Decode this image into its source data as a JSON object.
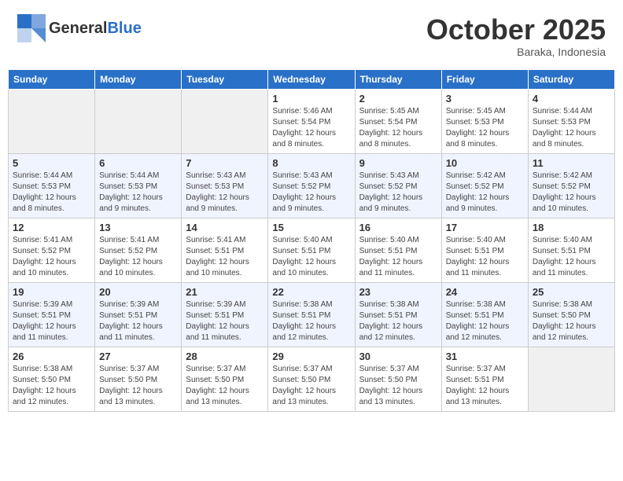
{
  "header": {
    "logo_line1": "General",
    "logo_line2": "Blue",
    "month": "October 2025",
    "location": "Baraka, Indonesia"
  },
  "weekdays": [
    "Sunday",
    "Monday",
    "Tuesday",
    "Wednesday",
    "Thursday",
    "Friday",
    "Saturday"
  ],
  "weeks": [
    [
      {
        "day": "",
        "info": ""
      },
      {
        "day": "",
        "info": ""
      },
      {
        "day": "",
        "info": ""
      },
      {
        "day": "1",
        "info": "Sunrise: 5:46 AM\nSunset: 5:54 PM\nDaylight: 12 hours and 8 minutes."
      },
      {
        "day": "2",
        "info": "Sunrise: 5:45 AM\nSunset: 5:54 PM\nDaylight: 12 hours and 8 minutes."
      },
      {
        "day": "3",
        "info": "Sunrise: 5:45 AM\nSunset: 5:53 PM\nDaylight: 12 hours and 8 minutes."
      },
      {
        "day": "4",
        "info": "Sunrise: 5:44 AM\nSunset: 5:53 PM\nDaylight: 12 hours and 8 minutes."
      }
    ],
    [
      {
        "day": "5",
        "info": "Sunrise: 5:44 AM\nSunset: 5:53 PM\nDaylight: 12 hours and 8 minutes."
      },
      {
        "day": "6",
        "info": "Sunrise: 5:44 AM\nSunset: 5:53 PM\nDaylight: 12 hours and 9 minutes."
      },
      {
        "day": "7",
        "info": "Sunrise: 5:43 AM\nSunset: 5:53 PM\nDaylight: 12 hours and 9 minutes."
      },
      {
        "day": "8",
        "info": "Sunrise: 5:43 AM\nSunset: 5:52 PM\nDaylight: 12 hours and 9 minutes."
      },
      {
        "day": "9",
        "info": "Sunrise: 5:43 AM\nSunset: 5:52 PM\nDaylight: 12 hours and 9 minutes."
      },
      {
        "day": "10",
        "info": "Sunrise: 5:42 AM\nSunset: 5:52 PM\nDaylight: 12 hours and 9 minutes."
      },
      {
        "day": "11",
        "info": "Sunrise: 5:42 AM\nSunset: 5:52 PM\nDaylight: 12 hours and 10 minutes."
      }
    ],
    [
      {
        "day": "12",
        "info": "Sunrise: 5:41 AM\nSunset: 5:52 PM\nDaylight: 12 hours and 10 minutes."
      },
      {
        "day": "13",
        "info": "Sunrise: 5:41 AM\nSunset: 5:52 PM\nDaylight: 12 hours and 10 minutes."
      },
      {
        "day": "14",
        "info": "Sunrise: 5:41 AM\nSunset: 5:51 PM\nDaylight: 12 hours and 10 minutes."
      },
      {
        "day": "15",
        "info": "Sunrise: 5:40 AM\nSunset: 5:51 PM\nDaylight: 12 hours and 10 minutes."
      },
      {
        "day": "16",
        "info": "Sunrise: 5:40 AM\nSunset: 5:51 PM\nDaylight: 12 hours and 11 minutes."
      },
      {
        "day": "17",
        "info": "Sunrise: 5:40 AM\nSunset: 5:51 PM\nDaylight: 12 hours and 11 minutes."
      },
      {
        "day": "18",
        "info": "Sunrise: 5:40 AM\nSunset: 5:51 PM\nDaylight: 12 hours and 11 minutes."
      }
    ],
    [
      {
        "day": "19",
        "info": "Sunrise: 5:39 AM\nSunset: 5:51 PM\nDaylight: 12 hours and 11 minutes."
      },
      {
        "day": "20",
        "info": "Sunrise: 5:39 AM\nSunset: 5:51 PM\nDaylight: 12 hours and 11 minutes."
      },
      {
        "day": "21",
        "info": "Sunrise: 5:39 AM\nSunset: 5:51 PM\nDaylight: 12 hours and 11 minutes."
      },
      {
        "day": "22",
        "info": "Sunrise: 5:38 AM\nSunset: 5:51 PM\nDaylight: 12 hours and 12 minutes."
      },
      {
        "day": "23",
        "info": "Sunrise: 5:38 AM\nSunset: 5:51 PM\nDaylight: 12 hours and 12 minutes."
      },
      {
        "day": "24",
        "info": "Sunrise: 5:38 AM\nSunset: 5:51 PM\nDaylight: 12 hours and 12 minutes."
      },
      {
        "day": "25",
        "info": "Sunrise: 5:38 AM\nSunset: 5:50 PM\nDaylight: 12 hours and 12 minutes."
      }
    ],
    [
      {
        "day": "26",
        "info": "Sunrise: 5:38 AM\nSunset: 5:50 PM\nDaylight: 12 hours and 12 minutes."
      },
      {
        "day": "27",
        "info": "Sunrise: 5:37 AM\nSunset: 5:50 PM\nDaylight: 12 hours and 13 minutes."
      },
      {
        "day": "28",
        "info": "Sunrise: 5:37 AM\nSunset: 5:50 PM\nDaylight: 12 hours and 13 minutes."
      },
      {
        "day": "29",
        "info": "Sunrise: 5:37 AM\nSunset: 5:50 PM\nDaylight: 12 hours and 13 minutes."
      },
      {
        "day": "30",
        "info": "Sunrise: 5:37 AM\nSunset: 5:50 PM\nDaylight: 12 hours and 13 minutes."
      },
      {
        "day": "31",
        "info": "Sunrise: 5:37 AM\nSunset: 5:51 PM\nDaylight: 12 hours and 13 minutes."
      },
      {
        "day": "",
        "info": ""
      }
    ]
  ]
}
